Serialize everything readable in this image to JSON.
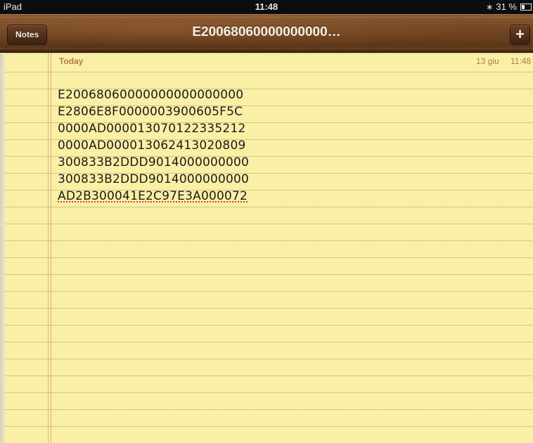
{
  "status_bar": {
    "device": "iPad",
    "time": "11:48",
    "bluetooth_icon": "bluetooth-icon",
    "battery_percent": "31 %",
    "battery_icon": "battery-icon"
  },
  "toolbar": {
    "notes_button_label": "Notes",
    "title": "E20068060000000000…",
    "add_button_label": "+"
  },
  "note": {
    "date_label": "Today",
    "date": "13 giu",
    "time": "11:48",
    "lines": [
      "E20068060000000000000000",
      "E2806E8F0000003900605F5C",
      "0000AD000013070122335212",
      "0000AD000013062413020809",
      "300833B2DDD9014000000000",
      "300833B2DDD9014000000000",
      "AD2B300041E2C97E3A000072"
    ]
  },
  "colors": {
    "paper": "#f9f0a6",
    "rule": "#b0a468",
    "margin": "#c8785a",
    "date_text": "#b37a4f",
    "leather": "#6f4424"
  }
}
